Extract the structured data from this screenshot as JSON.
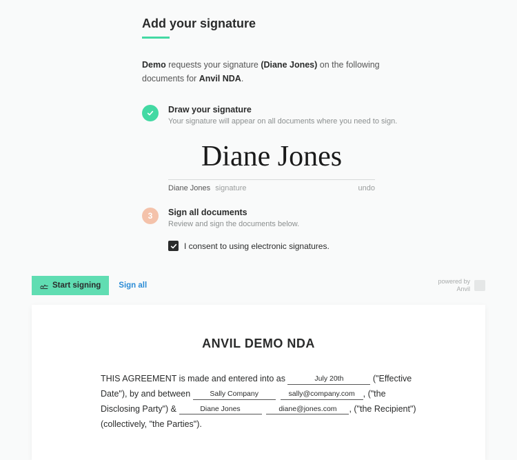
{
  "header": {
    "title": "Add your signature",
    "intro_prefix": "Demo",
    "intro_mid": " requests your signature ",
    "intro_name": "(Diane Jones)",
    "intro_tail1": " on the following documents for ",
    "intro_doc": "Anvil NDA",
    "intro_tail2": "."
  },
  "step_draw": {
    "title": "Draw your signature",
    "sub": "Your signature will appear on all documents where you need to sign."
  },
  "signature": {
    "cursive": "Diane Jones",
    "name": "Diane Jones",
    "label": "signature",
    "undo": "undo"
  },
  "step_sign": {
    "num": "3",
    "title": "Sign all documents",
    "sub": "Review and sign the documents below."
  },
  "consent": {
    "checked": true,
    "label": "I consent to using electronic signatures."
  },
  "docbar": {
    "start": "Start signing",
    "sign_all": "Sign all",
    "powered_by": "powered by",
    "brand": "Anvil"
  },
  "document": {
    "title": "ANVIL DEMO NDA",
    "line1_a": "THIS AGREEMENT is made and entered into as ",
    "fill_date": "July 20th",
    "line1_b": " (\"Effective Date\"), by and between ",
    "fill_party1": "Sally Company",
    "fill_email1": "sally@company.com",
    "line2_mid": ", (\"the Disclosing Party\") & ",
    "fill_party2": "Diane Jones",
    "fill_email2": "diane@jones.com",
    "line3": ", (\"the Recipient\") (collectively, \"the Parties\")."
  }
}
